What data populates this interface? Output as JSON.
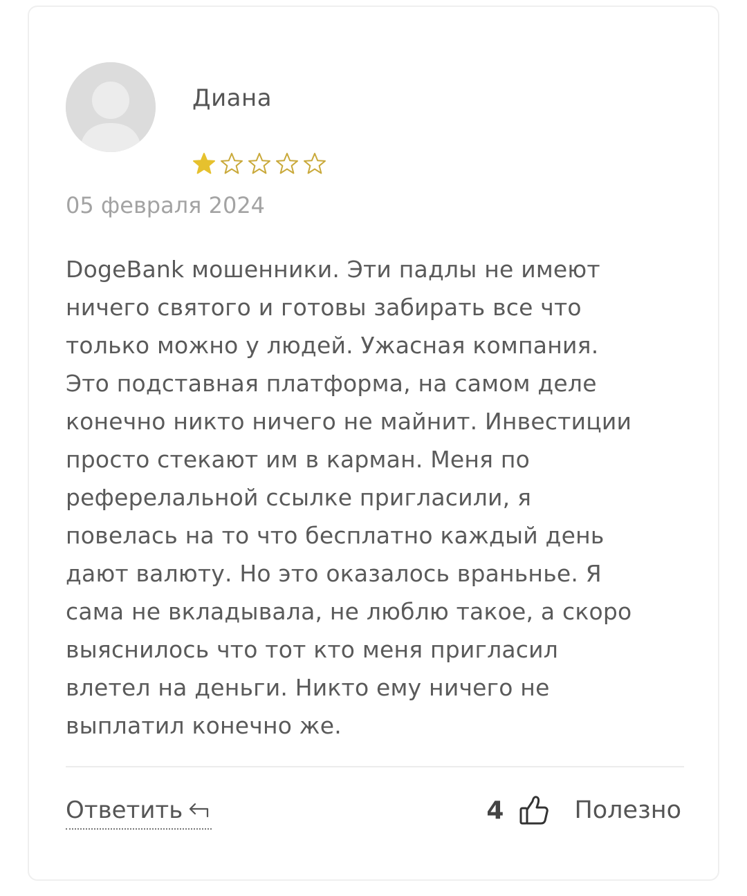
{
  "review": {
    "author": "Диана",
    "rating": 1,
    "rating_max": 5,
    "date": "05 февраля 2024",
    "text_lines": [
      "DogeBank мошенники. Эти падлы не имеют",
      "ничего святого и готовы забирать все что",
      "только можно у людей. Ужасная компания.",
      "Это подставная платформа, на самом деле",
      "конечно никто ничего не майнит. Инвестиции",
      "просто стекают им в карман. Меня по",
      "реферелальной ссылке пригласили, я",
      "повелась на то что бесплатно каждый день",
      "дают валюту. Но это оказалось враньнье. Я",
      "сама не вкладывала, не люблю такое, а скоро",
      "выяснилось что тот кто меня пригласил",
      "влетел на деньги. Никто ему ничего не",
      "выплатил конечно же."
    ]
  },
  "actions": {
    "reply_label": "Ответить",
    "useful_count": "4",
    "useful_label": "Полезно"
  },
  "icons": {
    "avatar": "default-user-avatar-icon",
    "star_filled": "star-filled-icon",
    "star_empty": "star-outline-icon",
    "reply": "reply-arrow-icon",
    "thumb": "thumbs-up-icon"
  },
  "colors": {
    "star_filled": "#e6c12e",
    "star_outline": "#c9a93a",
    "text": "#555555",
    "date": "#a3a3a3",
    "avatar_bg": "#dddddd",
    "avatar_fg": "#ececec"
  }
}
